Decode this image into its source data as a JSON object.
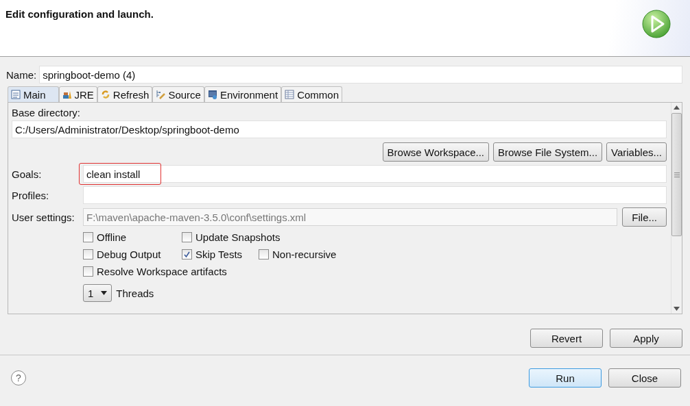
{
  "header": {
    "title": "Edit configuration and launch."
  },
  "name": {
    "label": "Name:",
    "value": "springboot-demo (4)"
  },
  "tabs": [
    {
      "label": "Main",
      "kind": "main",
      "selected": true
    },
    {
      "label": "JRE",
      "kind": "jre",
      "selected": false
    },
    {
      "label": "Refresh",
      "kind": "refresh",
      "selected": false
    },
    {
      "label": "Source",
      "kind": "source",
      "selected": false
    },
    {
      "label": "Environment",
      "kind": "environment",
      "selected": false
    },
    {
      "label": "Common",
      "kind": "common",
      "selected": false
    }
  ],
  "base_directory": {
    "label": "Base directory:",
    "value": "C:/Users/Administrator/Desktop/springboot-demo"
  },
  "browse_buttons": [
    "Browse Workspace...",
    "Browse File System...",
    "Variables..."
  ],
  "fields": [
    {
      "label": "Goals:",
      "value": "clean install",
      "disabled": false,
      "highlighted": true
    },
    {
      "label": "Profiles:",
      "disabled": false,
      "highlighted": false
    },
    {
      "label": "User settings:",
      "value": "F:\\maven\\apache-maven-3.5.0\\conf\\settings.xml",
      "disabled": true,
      "highlighted": false,
      "button": "File..."
    }
  ],
  "options": [
    [
      {
        "label": "Offline",
        "checked": false
      },
      {
        "label": "Update Snapshots",
        "checked": false
      }
    ],
    [
      {
        "label": "Debug Output",
        "checked": false
      },
      {
        "label": "Skip Tests",
        "checked": true
      },
      {
        "label": "Non-recursive",
        "checked": false
      }
    ],
    [
      {
        "label": "Resolve Workspace artifacts",
        "checked": false
      }
    ]
  ],
  "threads": {
    "value": "1",
    "label": "Threads"
  },
  "panel_buttons": [
    "Revert",
    "Apply"
  ],
  "help": "?",
  "footer_buttons": [
    {
      "label": "Run",
      "default": true
    },
    {
      "label": "Close",
      "default": false
    }
  ]
}
